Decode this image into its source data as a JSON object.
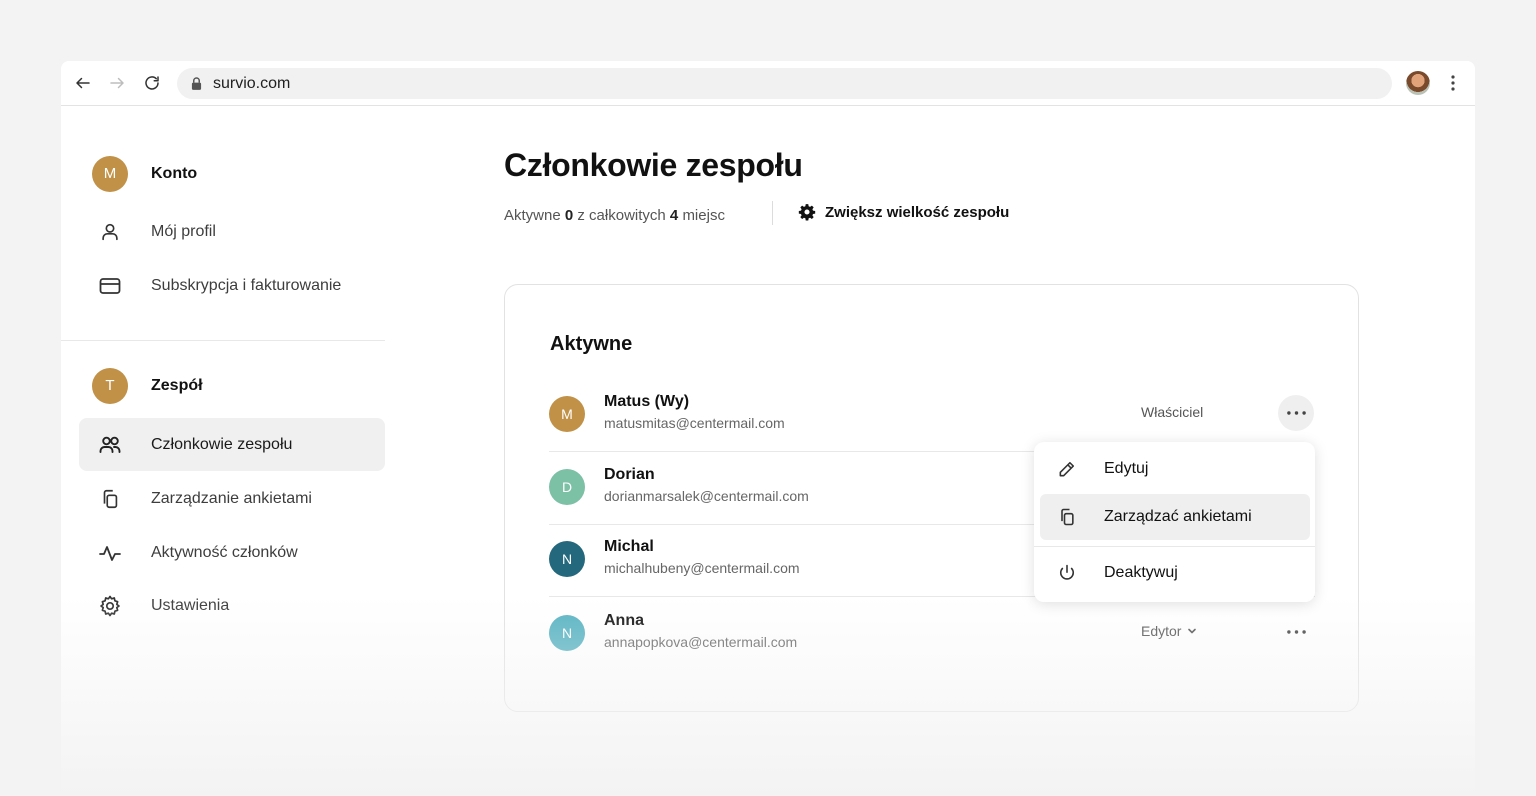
{
  "browser": {
    "url": "survio.com"
  },
  "sidebar": {
    "account_section": {
      "avatar_letter": "M",
      "title": "Konto",
      "items": [
        {
          "label": "Mój profil",
          "icon": "user-icon"
        },
        {
          "label": "Subskrypcja i fakturowanie",
          "icon": "credit-card-icon"
        }
      ]
    },
    "team_section": {
      "avatar_letter": "T",
      "title": "Zespół",
      "items": [
        {
          "label": "Członkowie zespołu",
          "icon": "users-icon",
          "active": true
        },
        {
          "label": "Zarządzanie ankietami",
          "icon": "copy-icon"
        },
        {
          "label": "Aktywność członków",
          "icon": "activity-icon"
        },
        {
          "label": "Ustawienia",
          "icon": "gear-icon"
        }
      ]
    }
  },
  "main": {
    "title": "Członkowie zespołu",
    "seats": {
      "prefix": "Aktywne",
      "active_count": "0",
      "middle": "z całkowitych",
      "total_count": "4",
      "suffix": "miejsc"
    },
    "increase_team_label": "Zwiększ wielkość zespołu",
    "card": {
      "title": "Aktywne",
      "members": [
        {
          "letter": "M",
          "name": "Matus (Wy)",
          "email": "matusmitas@centermail.com",
          "role": "Właściciel",
          "avatar_color": "#c09147"
        },
        {
          "letter": "D",
          "name": "Dorian",
          "email": "dorianmarsalek@centermail.com",
          "role": "",
          "avatar_color": "#7cc0a6"
        },
        {
          "letter": "N",
          "name": "Michal",
          "email": "michalhubeny@centermail.com",
          "role": "",
          "avatar_color": "#24687d"
        },
        {
          "letter": "N",
          "name": "Anna",
          "email": "annapopkova@centermail.com",
          "role": "Edytor",
          "avatar_color": "#57b3c2"
        }
      ]
    },
    "dropdown": {
      "items": [
        {
          "label": "Edytuj",
          "icon": "pencil-icon"
        },
        {
          "label": "Zarządzać ankietami",
          "icon": "copy-icon"
        },
        {
          "label": "Deaktywuj",
          "icon": "power-icon"
        }
      ]
    }
  },
  "colors": {
    "accent_avatar": "#c09147",
    "active_bg": "#f0f0f0"
  }
}
